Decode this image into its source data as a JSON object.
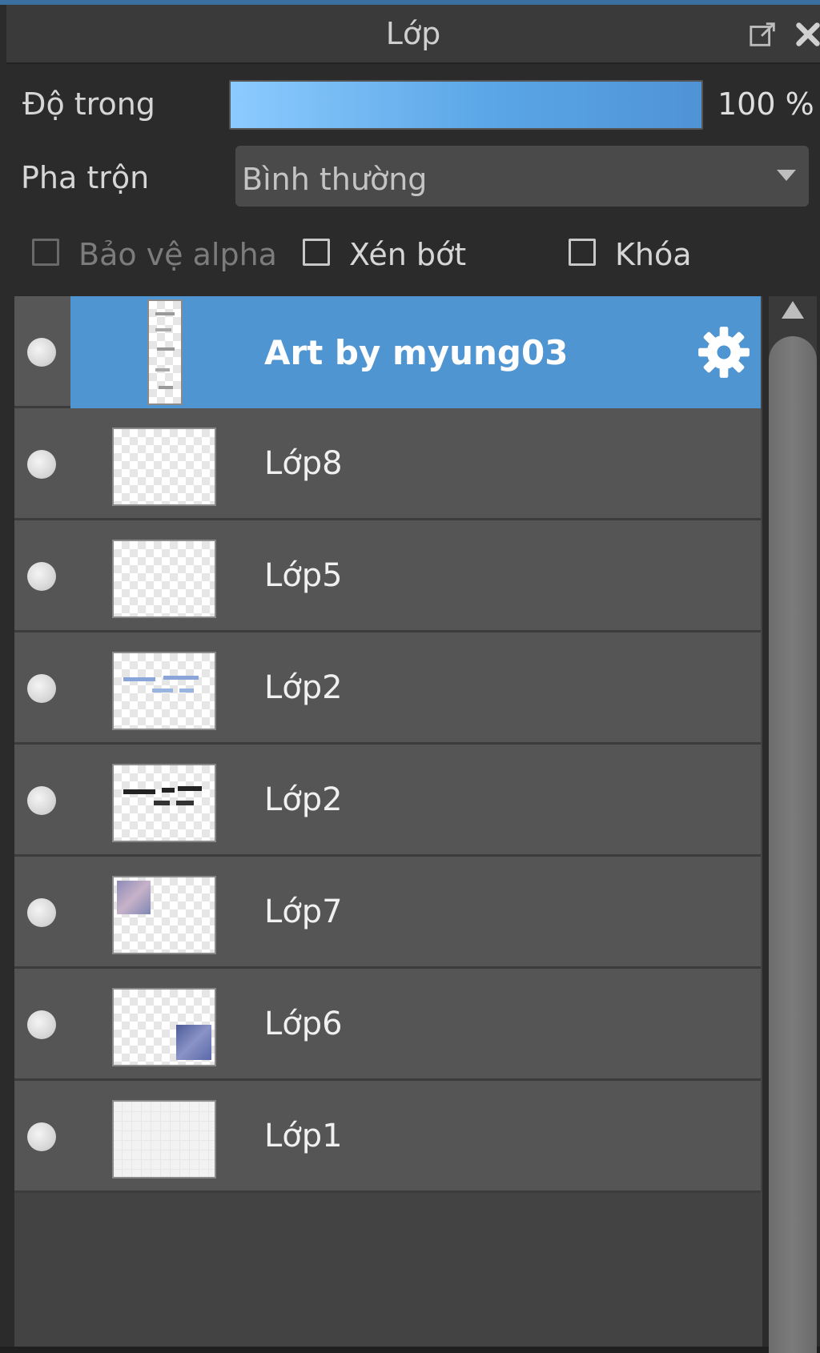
{
  "panel": {
    "title": "Lớp",
    "accent_color": "#4f95d2"
  },
  "icons": {
    "popout": "popout-icon",
    "close": "close-icon",
    "settings": "gear-icon",
    "visibility": "visibility-dot-icon",
    "dropdown": "chevron-down-icon",
    "scroll_up": "scroll-up-arrow-icon"
  },
  "opacity": {
    "label": "Độ trong",
    "value": "100 %",
    "level": 1.0
  },
  "blend": {
    "label": "Pha trộn",
    "value": "Bình thường"
  },
  "options": {
    "alpha_protect": {
      "label": "Bảo vệ alpha",
      "checked": false,
      "enabled": false
    },
    "clipping": {
      "label": "Xén bớt",
      "checked": false,
      "enabled": true
    },
    "lock": {
      "label": "Khóa",
      "checked": false,
      "enabled": true
    }
  },
  "layers": [
    {
      "name": "Art by myung03",
      "selected": true,
      "kind": "folder"
    },
    {
      "name": "Lớp8",
      "selected": false
    },
    {
      "name": "Lớp5",
      "selected": false
    },
    {
      "name": "Lớp2",
      "selected": false
    },
    {
      "name": "Lớp2",
      "selected": false
    },
    {
      "name": "Lớp7",
      "selected": false
    },
    {
      "name": "Lớp6",
      "selected": false
    },
    {
      "name": "Lớp1",
      "selected": false
    }
  ]
}
